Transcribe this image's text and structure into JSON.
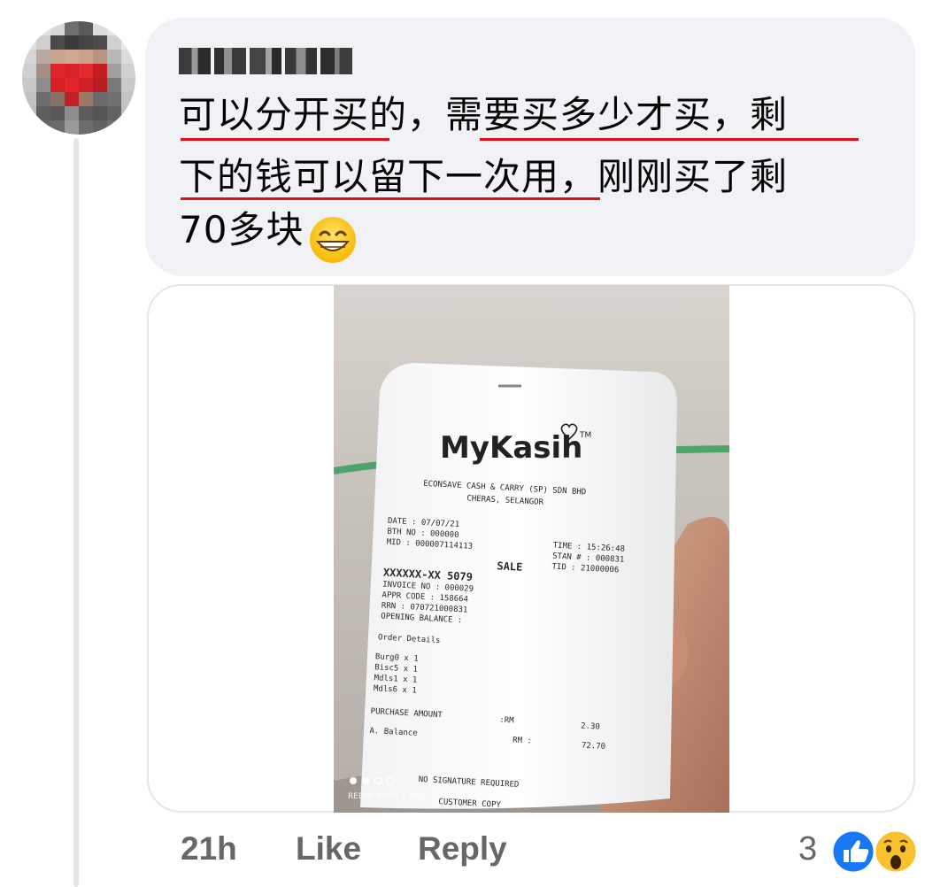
{
  "comment": {
    "author_name": "",
    "lines": [
      "可以分开买的，需要买多少才买，剩",
      "下的钱可以留下一次用，刚刚买了剩",
      "70多块"
    ],
    "emoji": "grinning-face-with-smiling-eyes"
  },
  "attachment": {
    "receipt": {
      "brand": "MyKasih",
      "trademark": "TM",
      "merchant": "ECONSAVE CASH & CARRY (SP) SDN BHD",
      "location": "CHERAS, SELANGOR",
      "date": "DATE : 07/07/21",
      "btch_no": "BTH NO : 000000",
      "mid": "MID : 000007114113",
      "time": "TIME : 15:26:48",
      "stan": "STAN # : 000831",
      "tid": "TID : 21000006",
      "sale": "SALE",
      "card": "XXXXXX-XX 5079",
      "invoice": "INVOICE NO : 000029",
      "appr": "APPR CODE : 158664",
      "rrn": "RRN : 070721000831",
      "opening": "OPENING BALANCE :",
      "order_details": "Order Details",
      "items": [
        "Burg0  x 1",
        "Bisc5  x 1",
        "Mdls1  x 1",
        "Mdls6  x 1"
      ],
      "purchase_label": "PURCHASE AMOUNT",
      "purchase_currency": ":RM",
      "purchase_value": "2.30",
      "balance_label": "A. Balance",
      "balance_currency": "RM :",
      "balance_value": "72.70",
      "no_signature": "NO SIGNATURE REQUIRED",
      "customer_copy": "CUSTOMER COPY"
    },
    "watermark": "REDMI NOTE 9 PRO",
    "carousel": {
      "total": 4,
      "active": 2
    }
  },
  "actions": {
    "timestamp": "21h",
    "like": "Like",
    "reply": "Reply",
    "reaction_count": "3",
    "reactions": [
      "like-icon",
      "wow-icon"
    ]
  },
  "colors": {
    "bubble": "#f0f2f5",
    "underline": "#e0101a",
    "meta_text": "#65676b",
    "like_blue": "#1877f2"
  }
}
